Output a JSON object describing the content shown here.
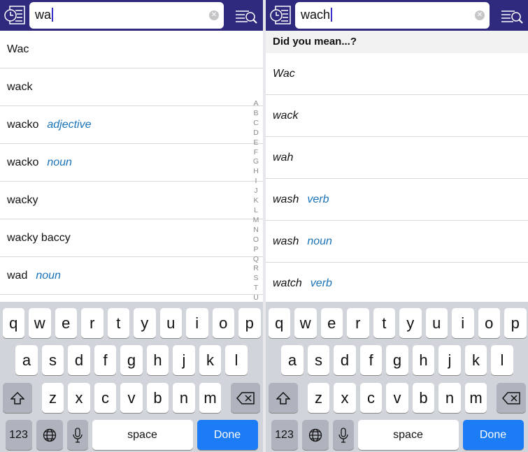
{
  "colors": {
    "header": "#2f2a7e",
    "accent": "#1a73b8",
    "done": "#1c7cf6"
  },
  "left": {
    "search_value": "wa",
    "results": [
      {
        "word": "Wac",
        "pos": ""
      },
      {
        "word": "wack",
        "pos": ""
      },
      {
        "word": "wacko",
        "pos": "adjective"
      },
      {
        "word": "wacko",
        "pos": "noun"
      },
      {
        "word": "wacky",
        "pos": ""
      },
      {
        "word": "wacky baccy",
        "pos": ""
      },
      {
        "word": "wad",
        "pos": "noun"
      }
    ],
    "index": [
      "A",
      "B",
      "C",
      "D",
      "E",
      "F",
      "G",
      "H",
      "I",
      "J",
      "K",
      "L",
      "M",
      "N",
      "O",
      "P",
      "Q",
      "R",
      "S",
      "T",
      "U"
    ]
  },
  "right": {
    "search_value": "wach",
    "suggest_header": "Did you mean...?",
    "results": [
      {
        "word": "Wac",
        "pos": ""
      },
      {
        "word": "wack",
        "pos": ""
      },
      {
        "word": "wah",
        "pos": ""
      },
      {
        "word": "wash",
        "pos": "verb"
      },
      {
        "word": "wash",
        "pos": "noun"
      },
      {
        "word": "watch",
        "pos": "verb"
      }
    ]
  },
  "keyboard": {
    "row1": [
      "q",
      "w",
      "e",
      "r",
      "t",
      "y",
      "u",
      "i",
      "o",
      "p"
    ],
    "row2": [
      "a",
      "s",
      "d",
      "f",
      "g",
      "h",
      "j",
      "k",
      "l"
    ],
    "row3": [
      "z",
      "x",
      "c",
      "v",
      "b",
      "n",
      "m"
    ],
    "numbers_label": "123",
    "space_label": "space",
    "done_label": "Done",
    "shift_icon": "shift-icon",
    "delete_icon": "backspace-icon",
    "globe_icon": "globe-icon",
    "mic_icon": "microphone-icon"
  }
}
